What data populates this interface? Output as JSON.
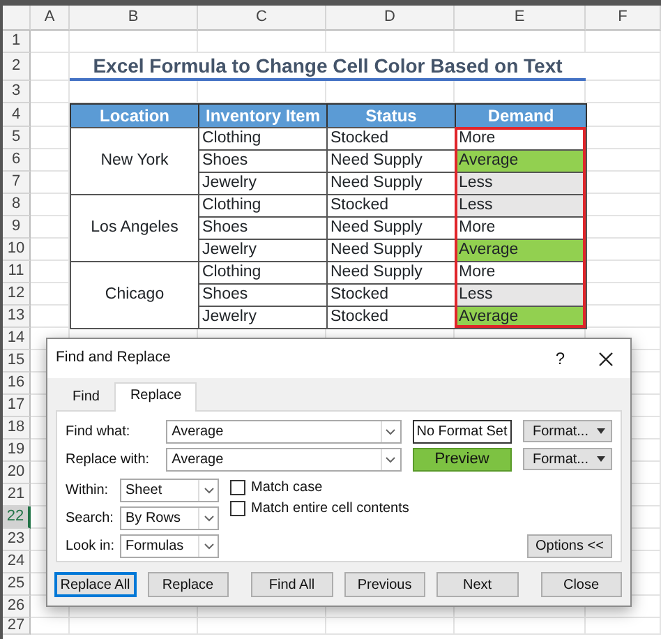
{
  "sheet": {
    "columns": [
      "A",
      "B",
      "C",
      "D",
      "E",
      "F"
    ],
    "row_numbers": [
      {
        "label": "1",
        "selected": false
      },
      {
        "label": "2",
        "selected": false
      },
      {
        "label": "3",
        "selected": false
      },
      {
        "label": "4",
        "selected": false
      },
      {
        "label": "5",
        "selected": false
      },
      {
        "label": "6",
        "selected": false
      },
      {
        "label": "7",
        "selected": false
      },
      {
        "label": "8",
        "selected": false
      },
      {
        "label": "9",
        "selected": false
      },
      {
        "label": "10",
        "selected": false
      },
      {
        "label": "11",
        "selected": false
      },
      {
        "label": "12",
        "selected": false
      },
      {
        "label": "13",
        "selected": false
      },
      {
        "label": "14",
        "selected": false
      },
      {
        "label": "15",
        "selected": false
      },
      {
        "label": "16",
        "selected": false
      },
      {
        "label": "17",
        "selected": false
      },
      {
        "label": "18",
        "selected": false
      },
      {
        "label": "19",
        "selected": false
      },
      {
        "label": "20",
        "selected": false
      },
      {
        "label": "21",
        "selected": false
      },
      {
        "label": "22",
        "selected": true
      },
      {
        "label": "23",
        "selected": false
      },
      {
        "label": "24",
        "selected": false
      },
      {
        "label": "25",
        "selected": false
      },
      {
        "label": "26",
        "selected": false
      },
      {
        "label": "27",
        "selected": false
      }
    ],
    "title": "Excel Formula to Change Cell Color Based on Text",
    "headers": [
      "Location",
      "Inventory Item",
      "Status",
      "Demand"
    ],
    "groups": [
      {
        "location": "New York",
        "rows": [
          {
            "item": "Clothing",
            "status": "Stocked",
            "demand": "More",
            "color": "#ffffff"
          },
          {
            "item": "Shoes",
            "status": "Need Supply",
            "demand": "Average",
            "color": "#92d050"
          },
          {
            "item": "Jewelry",
            "status": "Need Supply",
            "demand": "Less",
            "color": "#e7e6e6"
          }
        ]
      },
      {
        "location": "Los Angeles",
        "rows": [
          {
            "item": "Clothing",
            "status": "Stocked",
            "demand": "Less",
            "color": "#e7e6e6"
          },
          {
            "item": "Shoes",
            "status": "Need Supply",
            "demand": "More",
            "color": "#ffffff"
          },
          {
            "item": "Jewelry",
            "status": "Need Supply",
            "demand": "Average",
            "color": "#92d050"
          }
        ]
      },
      {
        "location": "Chicago",
        "rows": [
          {
            "item": "Clothing",
            "status": "Need Supply",
            "demand": "More",
            "color": "#ffffff"
          },
          {
            "item": "Shoes",
            "status": "Stocked",
            "demand": "Less",
            "color": "#e7e6e6"
          },
          {
            "item": "Jewelry",
            "status": "Stocked",
            "demand": "Average",
            "color": "#92d050"
          }
        ]
      }
    ]
  },
  "dialog": {
    "title": "Find and Replace",
    "help": "?",
    "tabs": [
      {
        "label": "Find",
        "selected": false
      },
      {
        "label": "Replace",
        "selected": true
      }
    ],
    "fields": [
      {
        "label": "Find what:",
        "value": "Average",
        "format": {
          "kind": "none",
          "text": "No Format Set"
        },
        "format_button": "Format..."
      },
      {
        "label": "Replace with:",
        "value": "Average",
        "format": {
          "kind": "preview",
          "text": "Preview"
        },
        "format_button": "Format..."
      }
    ],
    "selects": [
      {
        "label": "Within:",
        "value": "Sheet"
      },
      {
        "label": "Search:",
        "value": "By Rows"
      },
      {
        "label": "Look in:",
        "value": "Formulas"
      }
    ],
    "checkboxes": [
      {
        "label": "Match case",
        "checked": false
      },
      {
        "label": "Match entire cell contents",
        "checked": false
      }
    ],
    "options_button": "Options <<",
    "buttons": [
      {
        "label": "Replace All",
        "default": true
      },
      {
        "label": "Replace",
        "default": false
      },
      {
        "label": "Find All",
        "default": false
      },
      {
        "label": "Previous",
        "default": false
      },
      {
        "label": "Next",
        "default": false
      },
      {
        "label": "Close",
        "default": false
      }
    ]
  }
}
